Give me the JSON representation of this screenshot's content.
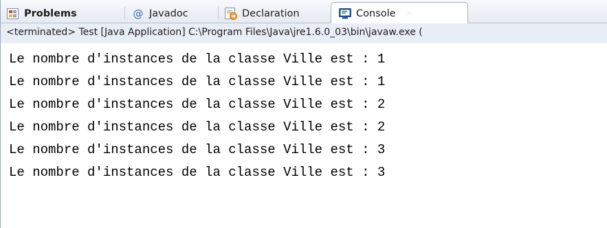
{
  "tabs": [
    {
      "id": "problems",
      "label": "Problems",
      "icon": "problems-icon",
      "bold": true
    },
    {
      "id": "javadoc",
      "label": "Javadoc",
      "icon": "at-sign-icon"
    },
    {
      "id": "declaration",
      "label": "Declaration",
      "icon": "declaration-icon"
    },
    {
      "id": "console",
      "label": "Console",
      "icon": "console-icon",
      "active": true
    }
  ],
  "console": {
    "status": "<terminated> Test [Java Application] C:\\Program Files\\Java\\jre1.6.0_03\\bin\\javaw.exe (",
    "lines": [
      "Le nombre d'instances de la classe Ville est : 1",
      "Le nombre d'instances de la classe Ville est : 1",
      "Le nombre d'instances de la classe Ville est : 2",
      "Le nombre d'instances de la classe Ville est : 2",
      "Le nombre d'instances de la classe Ville est : 3",
      "Le nombre d'instances de la classe Ville est : 3"
    ]
  },
  "colors": {
    "tab_bar_bg": "#e6ebf2",
    "status_bg": "#e9eef6",
    "active_tab_border": "#9fb0c8",
    "text": "#000000"
  }
}
